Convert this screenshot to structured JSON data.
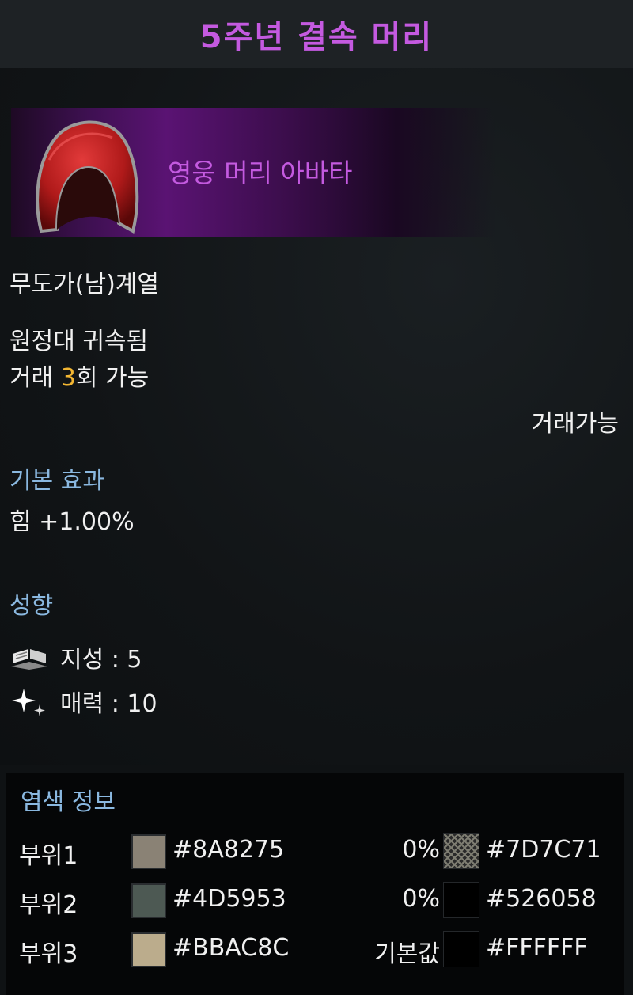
{
  "title": "5주년 결속 머리",
  "banner": {
    "label": "영웅 머리 아바타",
    "icon": "red-hood-icon"
  },
  "class_line": "무도가(남)계열",
  "bound": "원정대 귀속됨",
  "trade": {
    "prefix": "거래 ",
    "count": "3",
    "suffix": "회 가능"
  },
  "trade_status": "거래가능",
  "base_effect": {
    "heading": "기본 효과",
    "value": "힘 +1.00%"
  },
  "traits": {
    "heading": "성향",
    "items": [
      {
        "icon": "open-book-icon",
        "label": "지성 : 5"
      },
      {
        "icon": "sparkle-icon",
        "label": "매력 : 10"
      }
    ]
  },
  "dye": {
    "heading": "염색 정보",
    "rows": [
      {
        "part": "부위1",
        "color": "#8A8275",
        "pct": "0%",
        "color2": "#7D7C71",
        "pattern": true
      },
      {
        "part": "부위2",
        "color": "#4D5953",
        "pct": "0%",
        "color2": "#526058",
        "pattern": false
      },
      {
        "part": "부위3",
        "color": "#BBAC8C",
        "pct": "기본값",
        "color2": "#FFFFFF",
        "pattern": false
      }
    ]
  },
  "colors": {
    "title": "#c45ae0",
    "heading": "#8ab8e0",
    "accent": "#f2b632"
  }
}
